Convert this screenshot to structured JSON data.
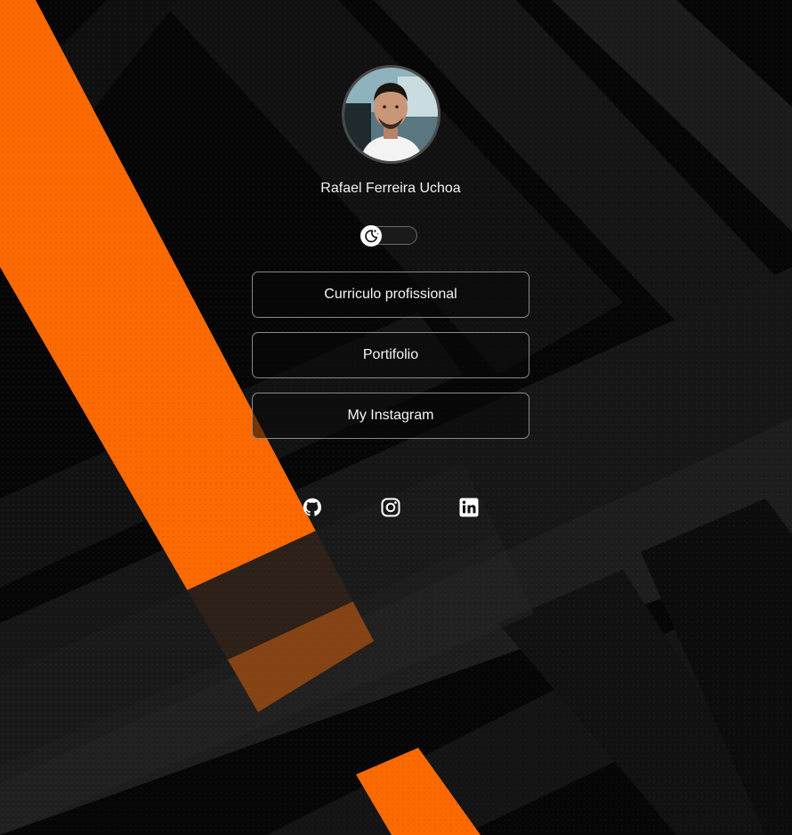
{
  "profile": {
    "name": "Rafael Ferreira Uchoa",
    "avatar_icon": "profile-photo"
  },
  "theme_toggle": {
    "icon": "moon-stars-icon",
    "state": "dark"
  },
  "links": [
    {
      "label": "Curriculo profissional"
    },
    {
      "label": "Portifolio"
    },
    {
      "label": "My Instagram"
    }
  ],
  "social": [
    {
      "icon": "github-icon"
    },
    {
      "icon": "instagram-icon"
    },
    {
      "icon": "linkedin-icon"
    }
  ],
  "colors": {
    "accent": "#ff6a00",
    "background": "#0a0a0a",
    "text": "#ffffff"
  }
}
